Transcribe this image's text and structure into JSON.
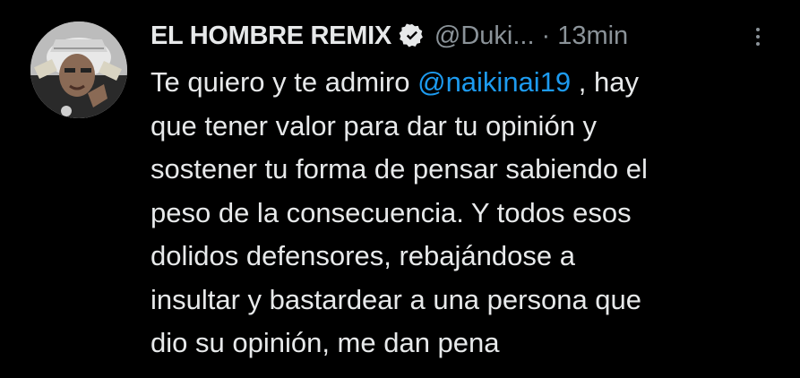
{
  "author": {
    "display_name": "EL HOMBRE REMIX",
    "handle": "@Duki...",
    "separator": "·",
    "time": "13min"
  },
  "icons": {
    "verified": "verified-badge-icon",
    "more": "more-vertical-icon",
    "avatar": "profile-avatar"
  },
  "colors": {
    "background": "#000000",
    "text": "#e7e9ea",
    "secondary": "#8b9399",
    "mention": "#1d9bf0"
  },
  "tweet": {
    "line1_pre": "Te quiero y te admiro ",
    "mention": "@naikinai19",
    "line1_post": " , hay",
    "line2": "que tener valor para dar tu opinión y",
    "line3": "sostener tu forma de pensar sabiendo el",
    "line4": "peso de la consecuencia. Y todos esos",
    "line5": "dolidos defensores, rebajándose a",
    "line6": "insultar y bastardear a una persona que",
    "line7": "dio su opinión, me dan pena"
  }
}
